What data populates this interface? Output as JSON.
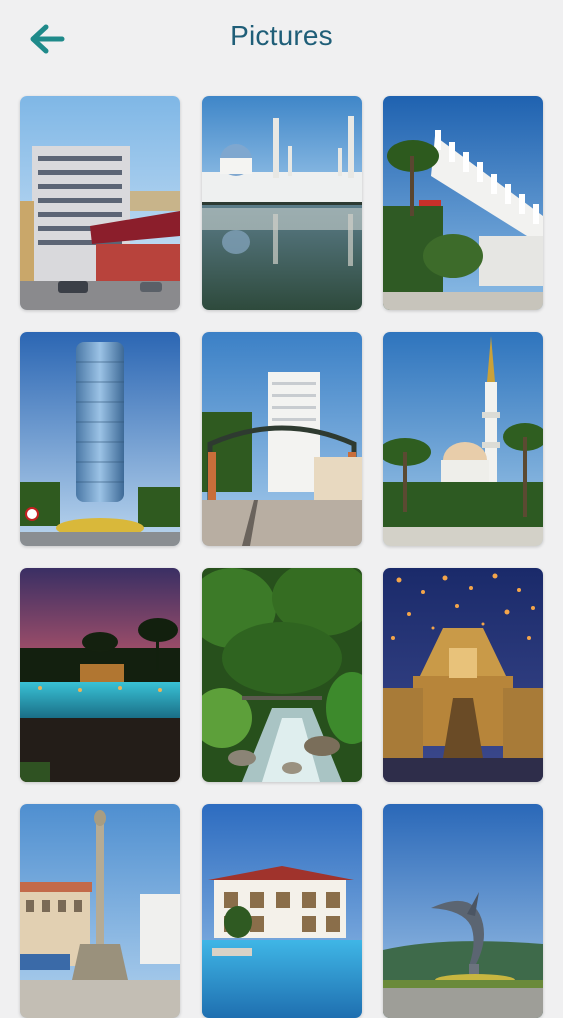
{
  "header": {
    "title": "Pictures",
    "back_icon": "arrow-left-icon",
    "accent_color": "#1f8a8a",
    "title_color": "#1f5e78"
  },
  "gallery": {
    "tiles": [
      {
        "name": "picture-city-street-building"
      },
      {
        "name": "picture-floating-mosque-reflection"
      },
      {
        "name": "picture-modern-pavilion-palms"
      },
      {
        "name": "picture-glass-tower"
      },
      {
        "name": "picture-arch-gate-plaza"
      },
      {
        "name": "picture-mosque-minaret-palms"
      },
      {
        "name": "picture-resort-pool-sunset"
      },
      {
        "name": "picture-jungle-stream"
      },
      {
        "name": "picture-temple-sky-lanterns"
      },
      {
        "name": "picture-town-square-column"
      },
      {
        "name": "picture-colonial-building-pool"
      },
      {
        "name": "picture-marlin-statue"
      }
    ]
  }
}
